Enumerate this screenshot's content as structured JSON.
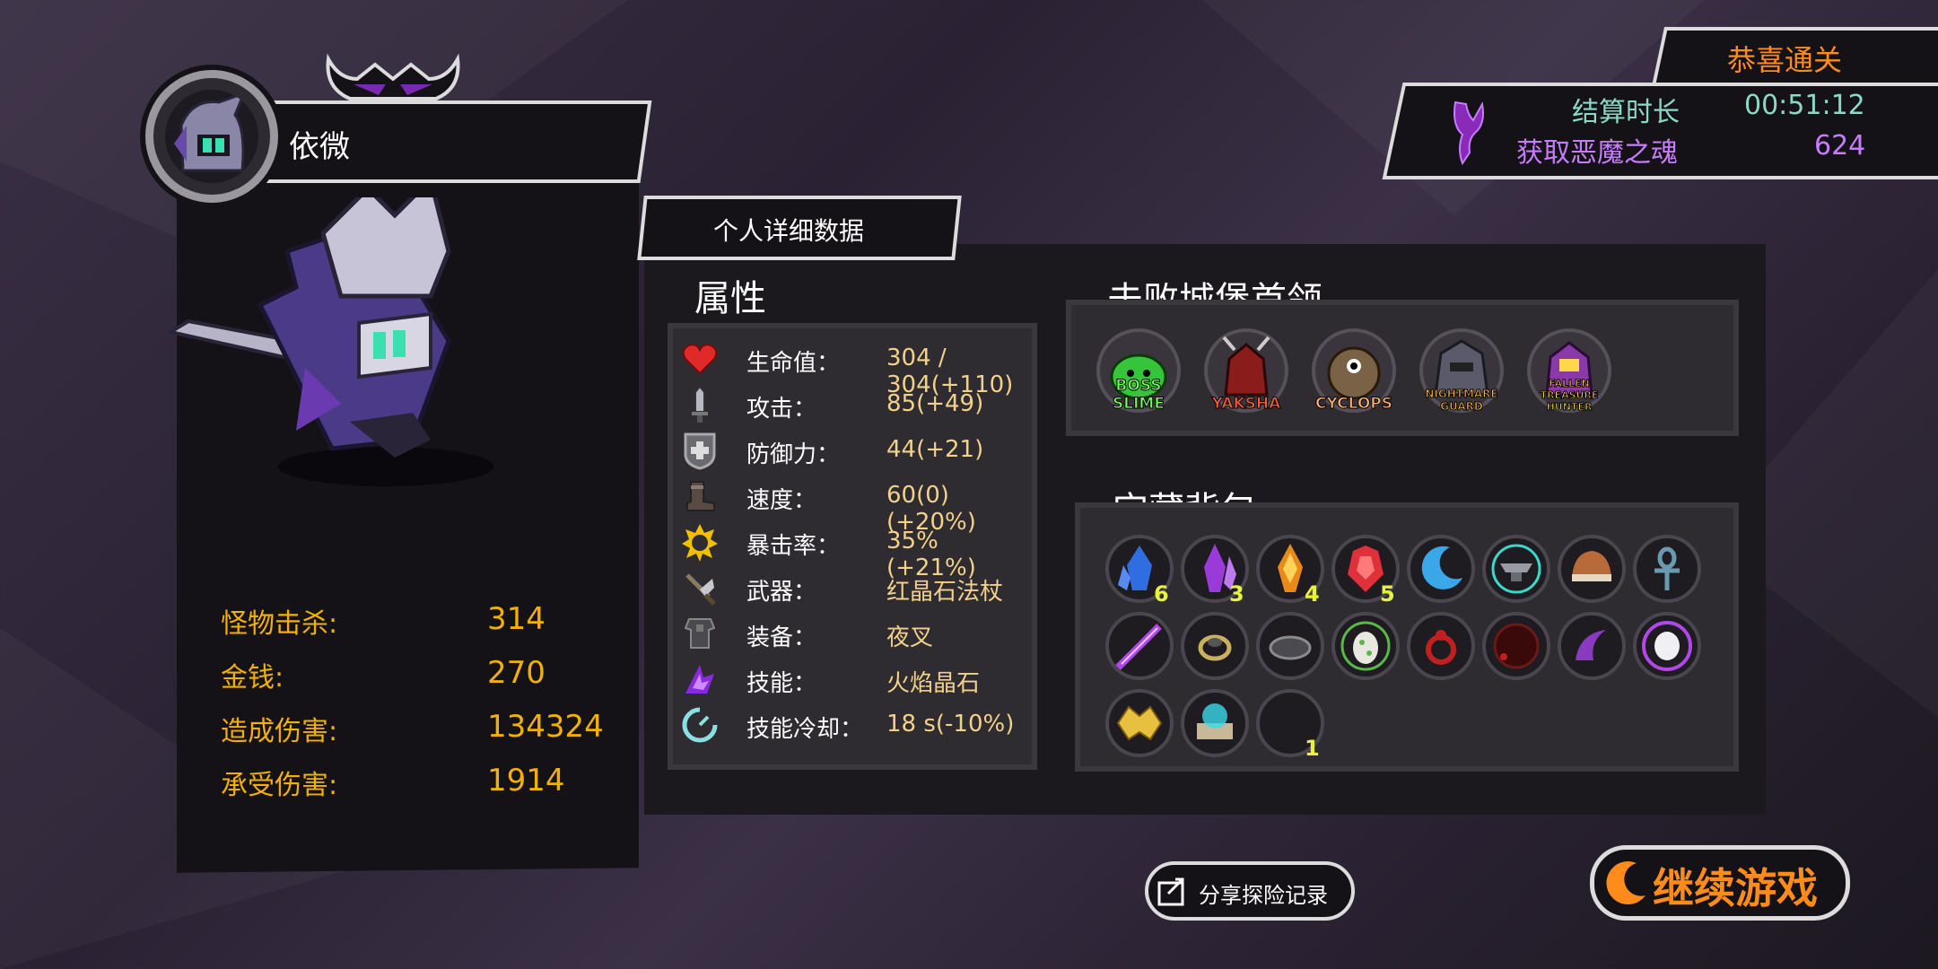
{
  "player": {
    "name": "依微",
    "stats": [
      {
        "label": "怪物击杀:",
        "value": "314"
      },
      {
        "label": "金钱:",
        "value": "270"
      },
      {
        "label": "造成伤害:",
        "value": "134324"
      },
      {
        "label": "承受伤害:",
        "value": "1914"
      }
    ]
  },
  "result": {
    "congrats": "恭喜通关",
    "rows": [
      {
        "label": "结算时长",
        "value": "00:51:12"
      },
      {
        "label": "获取恶魔之魂",
        "value": "624"
      }
    ]
  },
  "tab": {
    "label": "个人详细数据"
  },
  "attributes": {
    "title": "属性",
    "items": [
      {
        "icon": "heart-icon",
        "label": "生命值：",
        "value": "304 / 304(+110)"
      },
      {
        "icon": "sword-icon",
        "label": "攻击：",
        "value": "85(+49)"
      },
      {
        "icon": "shield-icon",
        "label": "防御力：",
        "value": "44(+21)"
      },
      {
        "icon": "boot-icon",
        "label": "速度：",
        "value": "60(0)(+20%)"
      },
      {
        "icon": "crit-sun-icon",
        "label": "暴击率：",
        "value": "35%(+21%)"
      },
      {
        "icon": "weapon-icon",
        "label": "武器：",
        "value": "红晶石法杖"
      },
      {
        "icon": "armor-icon",
        "label": "装备：",
        "value": "夜叉"
      },
      {
        "icon": "skill-icon",
        "label": "技能：",
        "value": "火焰晶石"
      },
      {
        "icon": "cooldown-icon",
        "label": "技能冷却：",
        "value": "18 s(-10%)"
      }
    ]
  },
  "bosses": {
    "title": "击败城堡首领",
    "items": [
      {
        "name": "BOSS SLIME",
        "color": "#35c43a",
        "text_color": "#7cff5a"
      },
      {
        "name": "YAKSHA",
        "color": "#8a1c1c",
        "text_color": "#ff5a3a"
      },
      {
        "name": "CYCLOPS",
        "color": "#7a6246",
        "text_color": "#ffb36b"
      },
      {
        "name": "NIGHTMARE GUARD",
        "color": "#5a5a6a",
        "text_color": "#ffb648"
      },
      {
        "name": "FALLEN TREASURE HUNTER",
        "color": "#8a3aa8",
        "text_color": "#ffd84a"
      }
    ]
  },
  "treasure": {
    "title": "宝藏背包",
    "items": [
      {
        "icon": "blue-crystal-icon",
        "color": "#2f6de0",
        "count": "6"
      },
      {
        "icon": "purple-crystal-icon",
        "color": "#9a3ad8",
        "count": "3"
      },
      {
        "icon": "orange-crystal-icon",
        "color": "#e88a1a",
        "count": "4"
      },
      {
        "icon": "red-crystal-icon",
        "color": "#e0303a",
        "count": "5"
      },
      {
        "icon": "crescent-moon-icon",
        "color": "#3aa8e8",
        "count": ""
      },
      {
        "icon": "anvil-icon",
        "color": "#3ad8c8",
        "count": ""
      },
      {
        "icon": "helmet-icon",
        "color": "#b86a3a",
        "count": ""
      },
      {
        "icon": "ankh-icon",
        "color": "#6a9ab0",
        "count": ""
      },
      {
        "icon": "purple-sword-icon",
        "color": "#b048e8",
        "count": ""
      },
      {
        "icon": "gold-ring-icon",
        "color": "#c8b060",
        "count": ""
      },
      {
        "icon": "gray-stone-icon",
        "color": "#6a6a70",
        "count": ""
      },
      {
        "icon": "egg-icon",
        "color": "#5ab848",
        "count": ""
      },
      {
        "icon": "red-amulet-icon",
        "color": "#c02020",
        "count": ""
      },
      {
        "icon": "dark-red-orb-icon",
        "color": "#6a1a1a",
        "count": ""
      },
      {
        "icon": "purple-claw-icon",
        "color": "#8a3ac0",
        "count": ""
      },
      {
        "icon": "white-feather-icon",
        "color": "#d8a8f0",
        "count": ""
      },
      {
        "icon": "golden-beast-icon",
        "color": "#e8c040",
        "count": ""
      },
      {
        "icon": "magic-scroll-icon",
        "color": "#3ad8e8",
        "count": ""
      },
      {
        "icon": "empty-slot-icon",
        "color": "#1e1b21",
        "count": "1"
      }
    ]
  },
  "buttons": {
    "share": "分享探险记录",
    "continue": "继续游戏"
  },
  "colors": {
    "gold": "#f2b000",
    "orange": "#ff8c1a",
    "teal": "#8ad8c8",
    "purple": "#c77dff"
  }
}
